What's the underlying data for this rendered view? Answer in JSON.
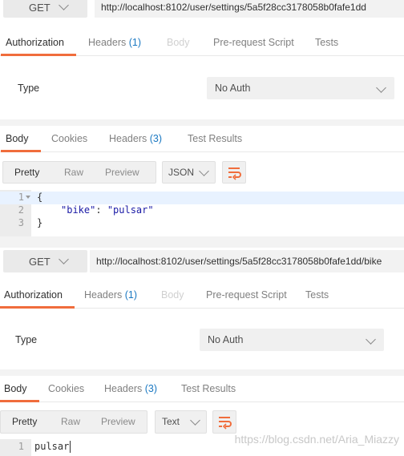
{
  "request1": {
    "method": "GET",
    "url": "http://localhost:8102/user/settings/5a5f28cc3178058b0fafe1dd",
    "tabs": [
      {
        "label": "Authorization"
      },
      {
        "label": "Headers ",
        "count": "(1)"
      },
      {
        "label": "Body"
      },
      {
        "label": "Pre-request Script"
      },
      {
        "label": "Tests"
      }
    ],
    "type_label": "Type",
    "auth_value": "No Auth"
  },
  "response1": {
    "tabs": [
      {
        "label": "Body"
      },
      {
        "label": "Cookies"
      },
      {
        "label": "Headers ",
        "count": "(3)"
      },
      {
        "label": "Test Results"
      }
    ],
    "views": [
      "Pretty",
      "Raw",
      "Preview"
    ],
    "format": "JSON",
    "lines": [
      "1",
      "2",
      "3"
    ],
    "code": {
      "l1": "{",
      "l2_key": "\"bike\"",
      "l2_colon": ": ",
      "l2_val": "\"pulsar\"",
      "l3": "}"
    }
  },
  "request2": {
    "method": "GET",
    "url": "http://localhost:8102/user/settings/5a5f28cc3178058b0fafe1dd/bike",
    "tabs": [
      {
        "label": "Authorization"
      },
      {
        "label": "Headers ",
        "count": "(1)"
      },
      {
        "label": "Body"
      },
      {
        "label": "Pre-request Script"
      },
      {
        "label": "Tests"
      }
    ],
    "type_label": "Type",
    "auth_value": "No Auth"
  },
  "response2": {
    "tabs": [
      {
        "label": "Body"
      },
      {
        "label": "Cookies"
      },
      {
        "label": "Headers ",
        "count": "(3)"
      },
      {
        "label": "Test Results"
      }
    ],
    "views": [
      "Pretty",
      "Raw",
      "Preview"
    ],
    "format": "Text",
    "lines": [
      "1"
    ],
    "code": {
      "l1": "pulsar"
    }
  },
  "watermark": "https://blog.csdn.net/Aria_Miazzy",
  "colors": {
    "accent": "#f06d3c",
    "count": "#1a78c2"
  },
  "icons": [
    "chevron-down-icon",
    "wrap-lines-icon",
    "fold-arrow-icon"
  ]
}
